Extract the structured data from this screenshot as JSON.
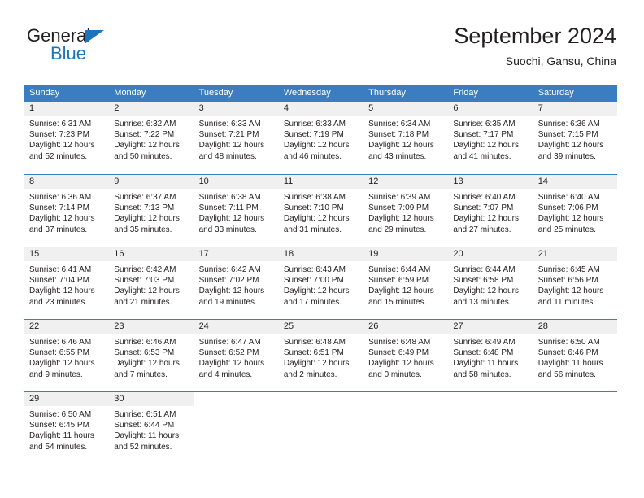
{
  "brand": {
    "name_top": "General",
    "name_bottom": "Blue",
    "triangle_color": "#1c75bc"
  },
  "header": {
    "title": "September 2024",
    "subtitle": "Suochi, Gansu, China"
  },
  "colors": {
    "header_blue": "#3b7dc1",
    "day_band_gray": "#f0f0f0",
    "text": "#231f20",
    "brand_blue": "#1c75bc"
  },
  "day_headers": [
    "Sunday",
    "Monday",
    "Tuesday",
    "Wednesday",
    "Thursday",
    "Friday",
    "Saturday"
  ],
  "weeks": [
    [
      {
        "date": "1",
        "sunrise": "Sunrise: 6:31 AM",
        "sunset": "Sunset: 7:23 PM",
        "daylight_line1": "Daylight: 12 hours",
        "daylight_line2": "and 52 minutes."
      },
      {
        "date": "2",
        "sunrise": "Sunrise: 6:32 AM",
        "sunset": "Sunset: 7:22 PM",
        "daylight_line1": "Daylight: 12 hours",
        "daylight_line2": "and 50 minutes."
      },
      {
        "date": "3",
        "sunrise": "Sunrise: 6:33 AM",
        "sunset": "Sunset: 7:21 PM",
        "daylight_line1": "Daylight: 12 hours",
        "daylight_line2": "and 48 minutes."
      },
      {
        "date": "4",
        "sunrise": "Sunrise: 6:33 AM",
        "sunset": "Sunset: 7:19 PM",
        "daylight_line1": "Daylight: 12 hours",
        "daylight_line2": "and 46 minutes."
      },
      {
        "date": "5",
        "sunrise": "Sunrise: 6:34 AM",
        "sunset": "Sunset: 7:18 PM",
        "daylight_line1": "Daylight: 12 hours",
        "daylight_line2": "and 43 minutes."
      },
      {
        "date": "6",
        "sunrise": "Sunrise: 6:35 AM",
        "sunset": "Sunset: 7:17 PM",
        "daylight_line1": "Daylight: 12 hours",
        "daylight_line2": "and 41 minutes."
      },
      {
        "date": "7",
        "sunrise": "Sunrise: 6:36 AM",
        "sunset": "Sunset: 7:15 PM",
        "daylight_line1": "Daylight: 12 hours",
        "daylight_line2": "and 39 minutes."
      }
    ],
    [
      {
        "date": "8",
        "sunrise": "Sunrise: 6:36 AM",
        "sunset": "Sunset: 7:14 PM",
        "daylight_line1": "Daylight: 12 hours",
        "daylight_line2": "and 37 minutes."
      },
      {
        "date": "9",
        "sunrise": "Sunrise: 6:37 AM",
        "sunset": "Sunset: 7:13 PM",
        "daylight_line1": "Daylight: 12 hours",
        "daylight_line2": "and 35 minutes."
      },
      {
        "date": "10",
        "sunrise": "Sunrise: 6:38 AM",
        "sunset": "Sunset: 7:11 PM",
        "daylight_line1": "Daylight: 12 hours",
        "daylight_line2": "and 33 minutes."
      },
      {
        "date": "11",
        "sunrise": "Sunrise: 6:38 AM",
        "sunset": "Sunset: 7:10 PM",
        "daylight_line1": "Daylight: 12 hours",
        "daylight_line2": "and 31 minutes."
      },
      {
        "date": "12",
        "sunrise": "Sunrise: 6:39 AM",
        "sunset": "Sunset: 7:09 PM",
        "daylight_line1": "Daylight: 12 hours",
        "daylight_line2": "and 29 minutes."
      },
      {
        "date": "13",
        "sunrise": "Sunrise: 6:40 AM",
        "sunset": "Sunset: 7:07 PM",
        "daylight_line1": "Daylight: 12 hours",
        "daylight_line2": "and 27 minutes."
      },
      {
        "date": "14",
        "sunrise": "Sunrise: 6:40 AM",
        "sunset": "Sunset: 7:06 PM",
        "daylight_line1": "Daylight: 12 hours",
        "daylight_line2": "and 25 minutes."
      }
    ],
    [
      {
        "date": "15",
        "sunrise": "Sunrise: 6:41 AM",
        "sunset": "Sunset: 7:04 PM",
        "daylight_line1": "Daylight: 12 hours",
        "daylight_line2": "and 23 minutes."
      },
      {
        "date": "16",
        "sunrise": "Sunrise: 6:42 AM",
        "sunset": "Sunset: 7:03 PM",
        "daylight_line1": "Daylight: 12 hours",
        "daylight_line2": "and 21 minutes."
      },
      {
        "date": "17",
        "sunrise": "Sunrise: 6:42 AM",
        "sunset": "Sunset: 7:02 PM",
        "daylight_line1": "Daylight: 12 hours",
        "daylight_line2": "and 19 minutes."
      },
      {
        "date": "18",
        "sunrise": "Sunrise: 6:43 AM",
        "sunset": "Sunset: 7:00 PM",
        "daylight_line1": "Daylight: 12 hours",
        "daylight_line2": "and 17 minutes."
      },
      {
        "date": "19",
        "sunrise": "Sunrise: 6:44 AM",
        "sunset": "Sunset: 6:59 PM",
        "daylight_line1": "Daylight: 12 hours",
        "daylight_line2": "and 15 minutes."
      },
      {
        "date": "20",
        "sunrise": "Sunrise: 6:44 AM",
        "sunset": "Sunset: 6:58 PM",
        "daylight_line1": "Daylight: 12 hours",
        "daylight_line2": "and 13 minutes."
      },
      {
        "date": "21",
        "sunrise": "Sunrise: 6:45 AM",
        "sunset": "Sunset: 6:56 PM",
        "daylight_line1": "Daylight: 12 hours",
        "daylight_line2": "and 11 minutes."
      }
    ],
    [
      {
        "date": "22",
        "sunrise": "Sunrise: 6:46 AM",
        "sunset": "Sunset: 6:55 PM",
        "daylight_line1": "Daylight: 12 hours",
        "daylight_line2": "and 9 minutes."
      },
      {
        "date": "23",
        "sunrise": "Sunrise: 6:46 AM",
        "sunset": "Sunset: 6:53 PM",
        "daylight_line1": "Daylight: 12 hours",
        "daylight_line2": "and 7 minutes."
      },
      {
        "date": "24",
        "sunrise": "Sunrise: 6:47 AM",
        "sunset": "Sunset: 6:52 PM",
        "daylight_line1": "Daylight: 12 hours",
        "daylight_line2": "and 4 minutes."
      },
      {
        "date": "25",
        "sunrise": "Sunrise: 6:48 AM",
        "sunset": "Sunset: 6:51 PM",
        "daylight_line1": "Daylight: 12 hours",
        "daylight_line2": "and 2 minutes."
      },
      {
        "date": "26",
        "sunrise": "Sunrise: 6:48 AM",
        "sunset": "Sunset: 6:49 PM",
        "daylight_line1": "Daylight: 12 hours",
        "daylight_line2": "and 0 minutes."
      },
      {
        "date": "27",
        "sunrise": "Sunrise: 6:49 AM",
        "sunset": "Sunset: 6:48 PM",
        "daylight_line1": "Daylight: 11 hours",
        "daylight_line2": "and 58 minutes."
      },
      {
        "date": "28",
        "sunrise": "Sunrise: 6:50 AM",
        "sunset": "Sunset: 6:46 PM",
        "daylight_line1": "Daylight: 11 hours",
        "daylight_line2": "and 56 minutes."
      }
    ],
    [
      {
        "date": "29",
        "sunrise": "Sunrise: 6:50 AM",
        "sunset": "Sunset: 6:45 PM",
        "daylight_line1": "Daylight: 11 hours",
        "daylight_line2": "and 54 minutes."
      },
      {
        "date": "30",
        "sunrise": "Sunrise: 6:51 AM",
        "sunset": "Sunset: 6:44 PM",
        "daylight_line1": "Daylight: 11 hours",
        "daylight_line2": "and 52 minutes."
      },
      {
        "date": "",
        "sunrise": "",
        "sunset": "",
        "daylight_line1": "",
        "daylight_line2": ""
      },
      {
        "date": "",
        "sunrise": "",
        "sunset": "",
        "daylight_line1": "",
        "daylight_line2": ""
      },
      {
        "date": "",
        "sunrise": "",
        "sunset": "",
        "daylight_line1": "",
        "daylight_line2": ""
      },
      {
        "date": "",
        "sunrise": "",
        "sunset": "",
        "daylight_line1": "",
        "daylight_line2": ""
      },
      {
        "date": "",
        "sunrise": "",
        "sunset": "",
        "daylight_line1": "",
        "daylight_line2": ""
      }
    ]
  ]
}
